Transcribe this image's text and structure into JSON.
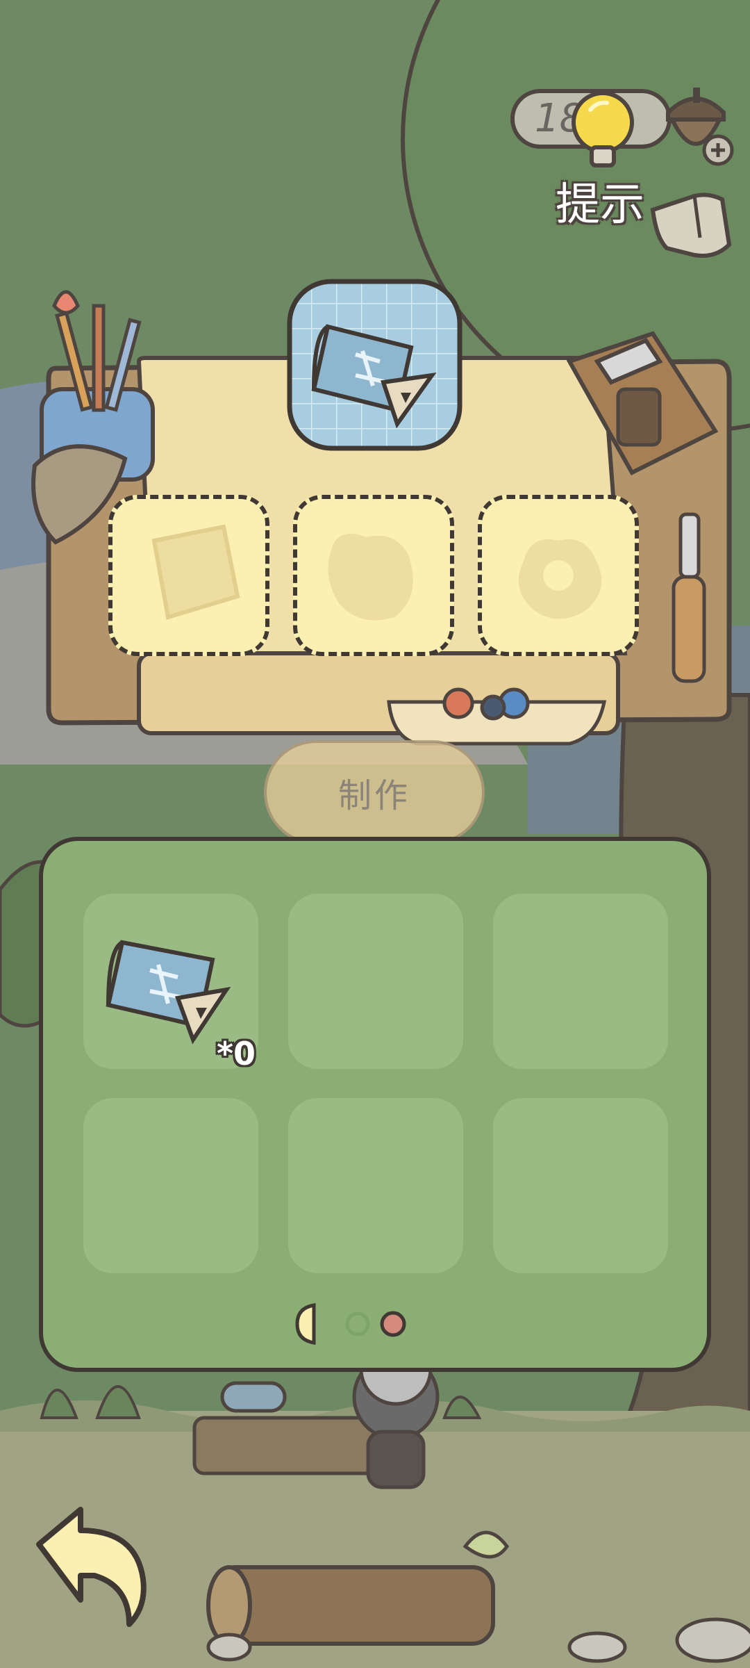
{
  "colors": {
    "background_green": "#6e8a64",
    "outline": "#3f3833",
    "slot_yellow": "#fbefb2",
    "panel_green": "#8aae74",
    "inventory_slot": "#9bbb85",
    "bench_cream": "#f1dfaa",
    "page_dot_active": "#d48a7c"
  },
  "hud": {
    "hint_count": "18",
    "hint_label": "提示",
    "bulb_icon": "lightbulb-icon",
    "acorn_icon": "acorn-plus-icon",
    "pointer_icon": "pointing-hand-icon"
  },
  "crafting": {
    "target_item_icon": "blueprint-scroll-icon",
    "slots": [
      {
        "ghost_icon": "square-plate-icon"
      },
      {
        "ghost_icon": "bread-loaf-icon"
      },
      {
        "ghost_icon": "pretzel-icon"
      }
    ],
    "make_label": "制作"
  },
  "inventory": {
    "items": [
      {
        "icon": "blueprint-scroll-icon",
        "count": "*0"
      }
    ],
    "pages": 3,
    "active_page": 3
  },
  "navigation": {
    "back_icon": "back-arrow-icon"
  }
}
